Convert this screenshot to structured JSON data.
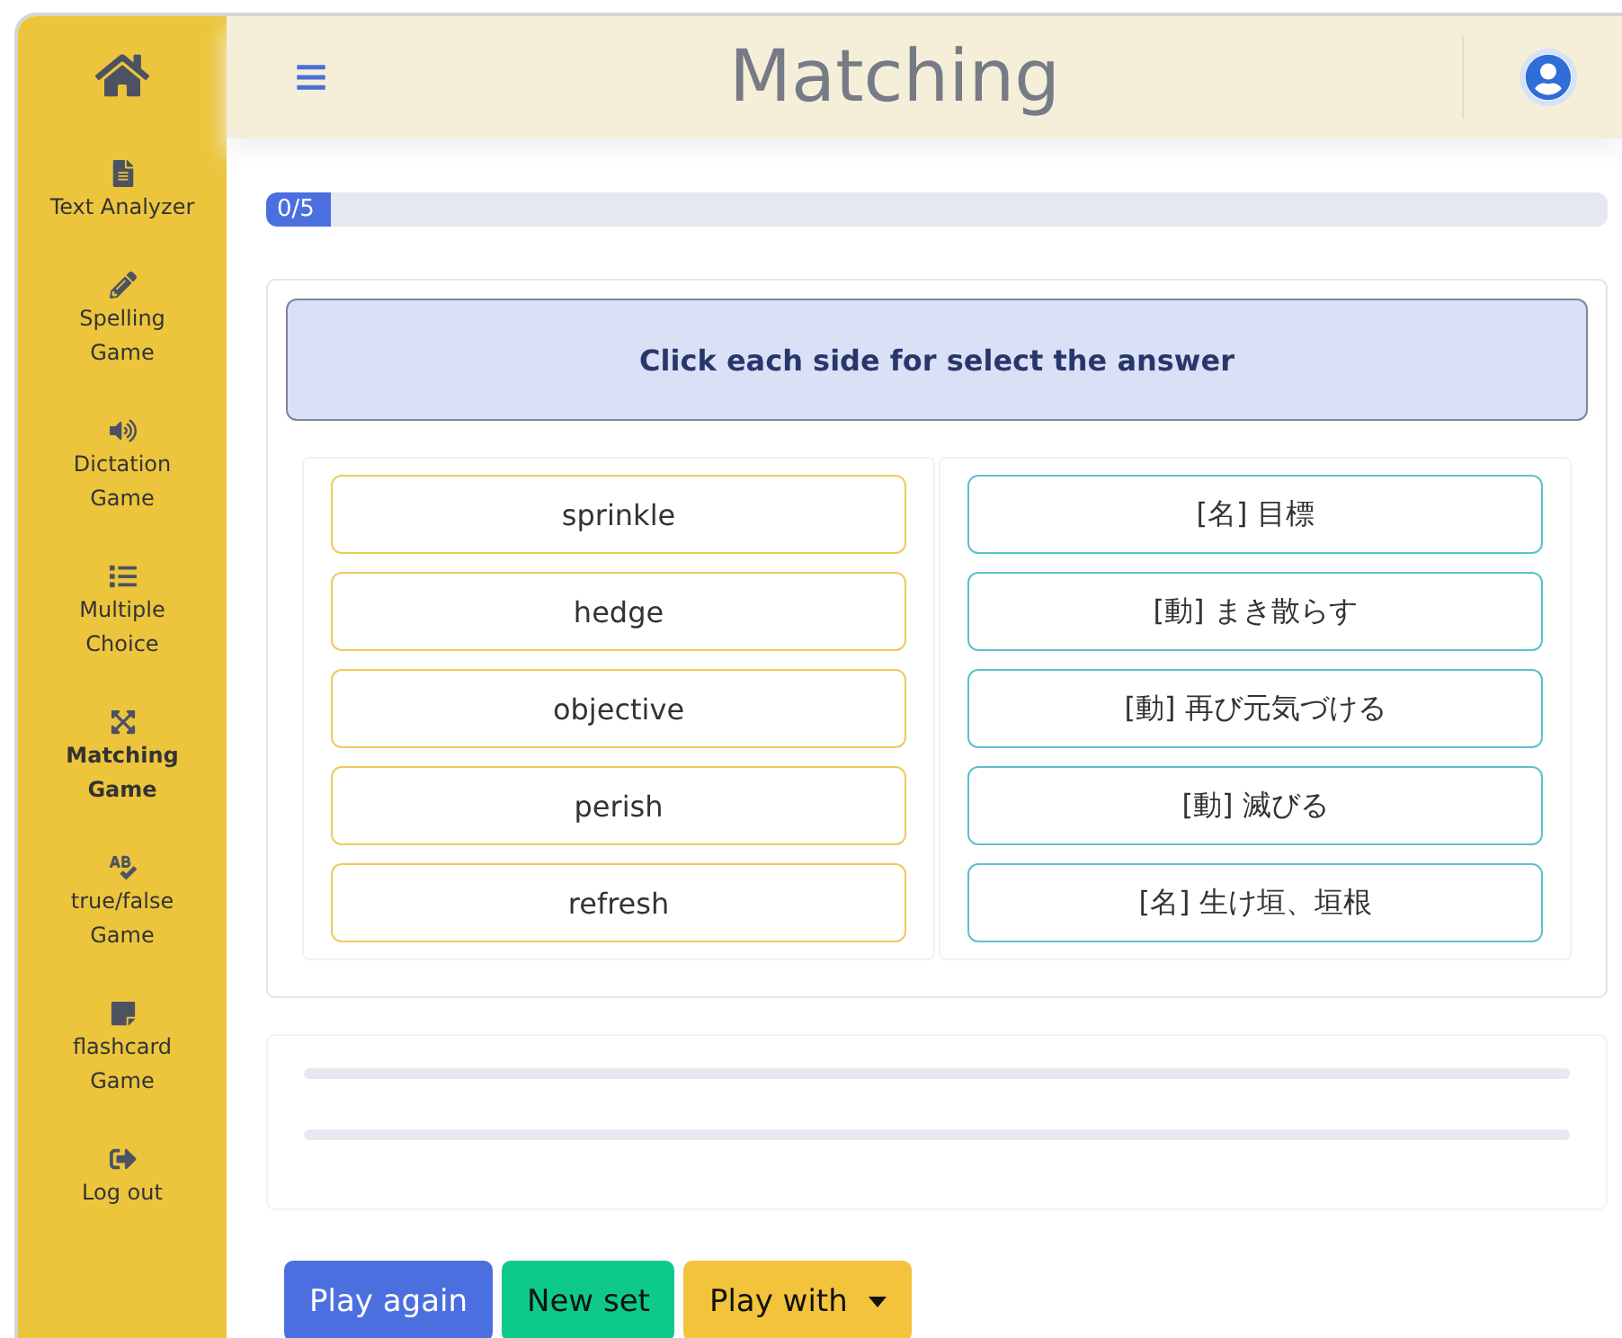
{
  "sidebar": {
    "items": [
      {
        "label": "Text Analyzer",
        "selected": false
      },
      {
        "label": "Spelling Game",
        "selected": false
      },
      {
        "label": "Dictation Game",
        "selected": false
      },
      {
        "label": "Multiple Choice",
        "selected": false
      },
      {
        "label": "Matching Game",
        "selected": true
      },
      {
        "label": "true/false Game",
        "selected": false
      },
      {
        "label": "flashcard Game",
        "selected": false
      },
      {
        "label": "Log out",
        "selected": false
      }
    ]
  },
  "header": {
    "title": "Matching"
  },
  "progress": {
    "label": "0/5",
    "level": 0
  },
  "instruction": "Click each side for select the answer",
  "left_words": [
    "sprinkle",
    "hedge",
    "objective",
    "perish",
    "refresh"
  ],
  "right_meanings": [
    "[名] 目標",
    "[動] まき散らす",
    "[動] 再び元気づける",
    "[動] 滅びる",
    "[名] 生け垣、垣根"
  ],
  "buttons": [
    {
      "label": "Play again",
      "kind": "primary"
    },
    {
      "label": "New set",
      "kind": "success"
    },
    {
      "label": "Play with",
      "kind": "dropdown"
    }
  ]
}
